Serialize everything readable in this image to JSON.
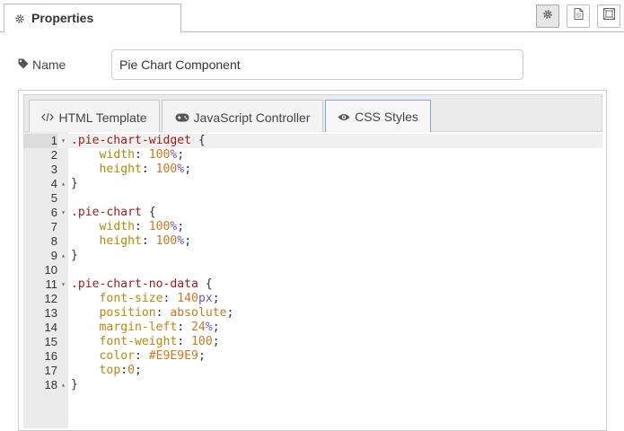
{
  "header": {
    "tab_label": "Properties",
    "tab_icon": "gear-icon",
    "tools": [
      "settings-icon",
      "document-icon",
      "layout-icon"
    ]
  },
  "name_field": {
    "label": "Name",
    "value": "Pie Chart Component"
  },
  "editor": {
    "tabs": [
      {
        "label": "HTML Template",
        "icon": "code-icon",
        "active": false
      },
      {
        "label": "JavaScript Controller",
        "icon": "gamepad-icon",
        "active": false
      },
      {
        "label": "CSS Styles",
        "icon": "eye-icon",
        "active": true
      }
    ],
    "active_line": 1,
    "lines": [
      {
        "n": "1",
        "fold": "open",
        "tokens": [
          {
            "t": "sel",
            "v": ".pie-chart-widget"
          },
          {
            "t": "pun",
            "v": " {"
          }
        ]
      },
      {
        "n": "2",
        "fold": "",
        "tokens": [
          {
            "t": "pun",
            "v": "    "
          },
          {
            "t": "prop",
            "v": "width"
          },
          {
            "t": "pun",
            "v": ": "
          },
          {
            "t": "num",
            "v": "100"
          },
          {
            "t": "unit",
            "v": "%"
          },
          {
            "t": "pun",
            "v": ";"
          }
        ]
      },
      {
        "n": "3",
        "fold": "",
        "tokens": [
          {
            "t": "pun",
            "v": "    "
          },
          {
            "t": "prop",
            "v": "height"
          },
          {
            "t": "pun",
            "v": ": "
          },
          {
            "t": "num",
            "v": "100"
          },
          {
            "t": "unit",
            "v": "%"
          },
          {
            "t": "pun",
            "v": ";"
          }
        ]
      },
      {
        "n": "4",
        "fold": "close",
        "tokens": [
          {
            "t": "pun",
            "v": "}"
          }
        ]
      },
      {
        "n": "5",
        "fold": "",
        "tokens": []
      },
      {
        "n": "6",
        "fold": "open",
        "tokens": [
          {
            "t": "sel",
            "v": ".pie-chart"
          },
          {
            "t": "pun",
            "v": " {"
          }
        ]
      },
      {
        "n": "7",
        "fold": "",
        "tokens": [
          {
            "t": "pun",
            "v": "    "
          },
          {
            "t": "prop",
            "v": "width"
          },
          {
            "t": "pun",
            "v": ": "
          },
          {
            "t": "num",
            "v": "100"
          },
          {
            "t": "unit",
            "v": "%"
          },
          {
            "t": "pun",
            "v": ";"
          }
        ]
      },
      {
        "n": "8",
        "fold": "",
        "tokens": [
          {
            "t": "pun",
            "v": "    "
          },
          {
            "t": "prop",
            "v": "height"
          },
          {
            "t": "pun",
            "v": ": "
          },
          {
            "t": "num",
            "v": "100"
          },
          {
            "t": "unit",
            "v": "%"
          },
          {
            "t": "pun",
            "v": ";"
          }
        ]
      },
      {
        "n": "9",
        "fold": "close",
        "tokens": [
          {
            "t": "pun",
            "v": "}"
          }
        ]
      },
      {
        "n": "10",
        "fold": "",
        "tokens": []
      },
      {
        "n": "11",
        "fold": "open",
        "tokens": [
          {
            "t": "sel",
            "v": ".pie-chart-no-data"
          },
          {
            "t": "pun",
            "v": " {"
          }
        ]
      },
      {
        "n": "12",
        "fold": "",
        "tokens": [
          {
            "t": "pun",
            "v": "    "
          },
          {
            "t": "prop",
            "v": "font-size"
          },
          {
            "t": "pun",
            "v": ": "
          },
          {
            "t": "num",
            "v": "140"
          },
          {
            "t": "unit",
            "v": "px"
          },
          {
            "t": "pun",
            "v": ";"
          }
        ]
      },
      {
        "n": "13",
        "fold": "",
        "tokens": [
          {
            "t": "pun",
            "v": "    "
          },
          {
            "t": "prop",
            "v": "position"
          },
          {
            "t": "pun",
            "v": ": "
          },
          {
            "t": "kw",
            "v": "absolute"
          },
          {
            "t": "pun",
            "v": ";"
          }
        ]
      },
      {
        "n": "14",
        "fold": "",
        "tokens": [
          {
            "t": "pun",
            "v": "    "
          },
          {
            "t": "prop",
            "v": "margin-left"
          },
          {
            "t": "pun",
            "v": ": "
          },
          {
            "t": "num",
            "v": "24"
          },
          {
            "t": "unit",
            "v": "%"
          },
          {
            "t": "pun",
            "v": ";"
          }
        ]
      },
      {
        "n": "15",
        "fold": "",
        "tokens": [
          {
            "t": "pun",
            "v": "    "
          },
          {
            "t": "prop",
            "v": "font-weight"
          },
          {
            "t": "pun",
            "v": ": "
          },
          {
            "t": "num",
            "v": "100"
          },
          {
            "t": "pun",
            "v": ";"
          }
        ]
      },
      {
        "n": "16",
        "fold": "",
        "tokens": [
          {
            "t": "pun",
            "v": "    "
          },
          {
            "t": "prop",
            "v": "color"
          },
          {
            "t": "pun",
            "v": ": "
          },
          {
            "t": "num",
            "v": "#E9E9E9"
          },
          {
            "t": "pun",
            "v": ";"
          }
        ]
      },
      {
        "n": "17",
        "fold": "",
        "tokens": [
          {
            "t": "pun",
            "v": "    "
          },
          {
            "t": "prop",
            "v": "top"
          },
          {
            "t": "pun",
            "v": ":"
          },
          {
            "t": "num",
            "v": "0"
          },
          {
            "t": "pun",
            "v": ";"
          }
        ]
      },
      {
        "n": "18",
        "fold": "close",
        "tokens": [
          {
            "t": "pun",
            "v": "}"
          }
        ]
      }
    ]
  },
  "colors": {
    "selector": "#9c1b1b",
    "property": "#b8860b",
    "number": "#c8791f",
    "unit": "#7d4fb2",
    "active_tab_border": "#7ea6d8",
    "gutter": "#ebebeb"
  }
}
